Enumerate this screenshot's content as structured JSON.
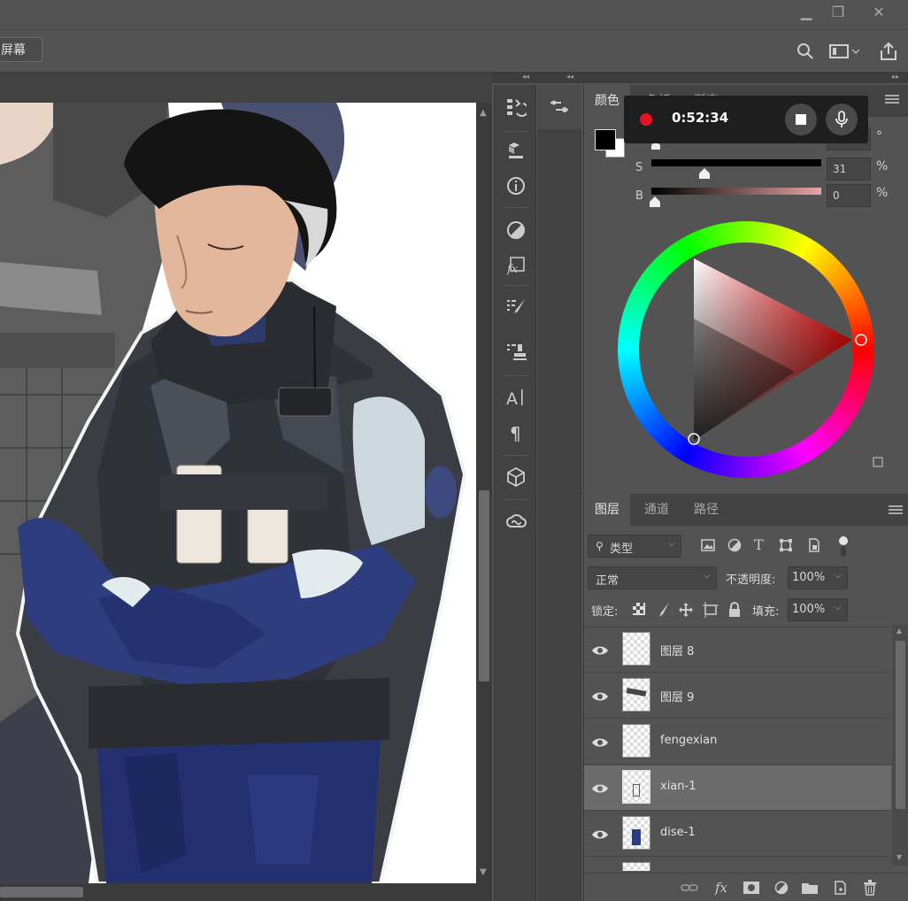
{
  "window": {
    "minimize_glyph": "▁",
    "restore_glyph": "❐",
    "close_glyph": "✕"
  },
  "options_bar": {
    "screen_mode_label": "屏幕"
  },
  "tool_icons": [
    "history-icon",
    "3d-material-icon",
    "info-icon",
    "adjustments-icon",
    "styles-icon",
    "brush-settings-icon",
    "clone-source-icon",
    "character-icon",
    "paragraph-icon",
    "3d-icon",
    "creative-cloud-icon"
  ],
  "color_panel": {
    "tabs": [
      "颜色",
      "色板",
      "渐变"
    ],
    "hue_unit": "°",
    "saturation": {
      "label": "S",
      "value": "31",
      "unit": "%",
      "level": 0.31
    },
    "brightness": {
      "label": "B",
      "value": "0",
      "unit": "%",
      "level": 0.0
    },
    "foreground": "#000000",
    "background": "#ffffff"
  },
  "recorder": {
    "time": "0:52:34",
    "record_color": "#e81123"
  },
  "layers_panel": {
    "tabs": [
      "图层",
      "通道",
      "路径"
    ],
    "filter_label": "类型",
    "blend_mode": "正常",
    "opacity_label": "不透明度:",
    "opacity_value": "100%",
    "lock_label": "锁定:",
    "fill_label": "填充:",
    "fill_value": "100%",
    "layers": [
      {
        "name": "图层 8",
        "selected": false
      },
      {
        "name": "图层 9",
        "selected": false
      },
      {
        "name": "fengexian",
        "selected": false
      },
      {
        "name": "xian-1",
        "selected": true
      },
      {
        "name": "dise-1",
        "selected": false
      }
    ],
    "bottom_fx": "fx"
  }
}
